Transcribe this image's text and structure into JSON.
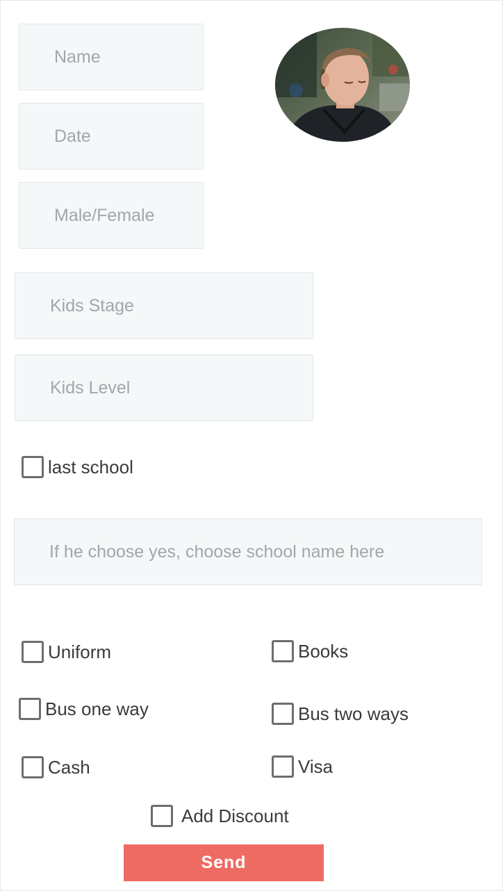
{
  "form": {
    "name_placeholder": "Name",
    "date_placeholder": "Date",
    "gender_placeholder": "Male/Female",
    "kids_stage_placeholder": "Kids Stage",
    "kids_level_placeholder": "Kids Level",
    "last_school_label": "last school",
    "school_name_placeholder": "If he choose yes, choose school name here"
  },
  "options": {
    "uniform": "Uniform",
    "books": "Books",
    "bus_one_way": "Bus one way",
    "bus_two_ways": "Bus two ways",
    "cash": "Cash",
    "visa": "Visa",
    "add_discount": "Add Discount"
  },
  "actions": {
    "send_label": "Send"
  },
  "colors": {
    "field_background": "#f5f8f8",
    "placeholder_text": "#a2a6a8",
    "send_button": "#ee6b63"
  },
  "icons": {
    "profile": "profile-photo"
  }
}
